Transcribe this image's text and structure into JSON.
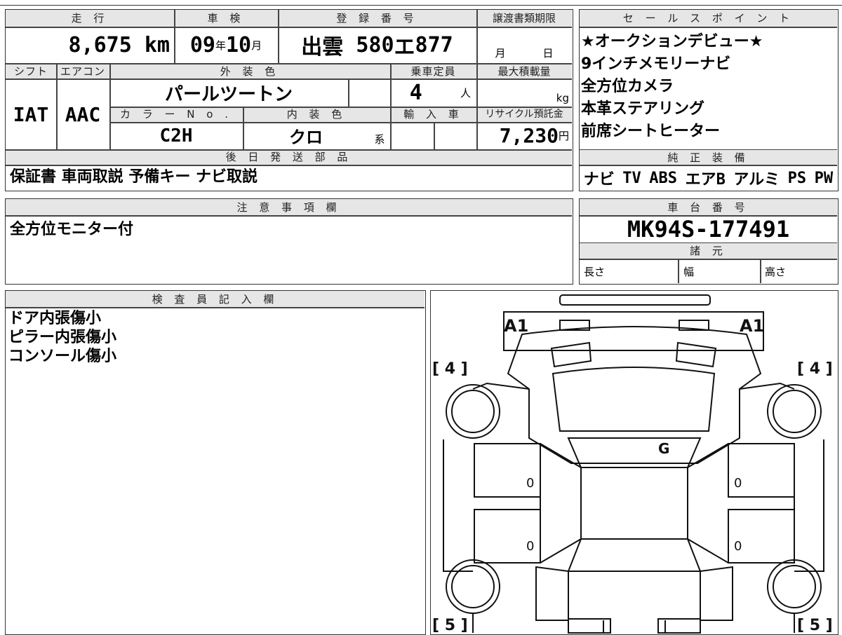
{
  "top": {
    "mileage_label": "走 行",
    "shaken_label": "車 検",
    "reg_label": "登 録 番 号",
    "transfer_label": "譲渡書類期限",
    "mileage": "8,675",
    "mileage_unit": "km",
    "shaken_year": "09",
    "shaken_year_unit": "年",
    "shaken_month": "10",
    "shaken_month_unit": "月",
    "reg_place": "出雲",
    "reg_class": "580",
    "reg_kana": "エ",
    "reg_number": "877",
    "transfer_month_unit": "月",
    "transfer_day_unit": "日",
    "shift_label": "シフト",
    "ac_label": "エアコン",
    "ext_color_label": "外 装 色",
    "capacity_label": "乗車定員",
    "max_load_label": "最大積載量",
    "shift": "IAT",
    "ac": "AAC",
    "ext_color": "パールツートン",
    "capacity": "4",
    "capacity_unit": "人",
    "load_unit": "kg",
    "color_no_label": "カ ラ ー N o .",
    "int_color_label": "内 装 色",
    "import_label": "輸 入 車",
    "recycle_label": "リサイクル預託金",
    "color_no": "C2H",
    "int_color": "クロ",
    "int_color_suffix": "系",
    "recycle": "7,230",
    "recycle_unit": "円",
    "later_label": "後 日 発 送 部 品",
    "later_items": "保証書 車両取説 予備キー ナビ取説"
  },
  "sales": {
    "label": "セ ー ル ス ポ イ ン ト",
    "points": [
      "★オークションデビュー★",
      "9インチメモリーナビ",
      "全方位カメラ",
      "本革ステアリング",
      "前席シートヒーター"
    ],
    "equip_label": "純 正 装 備",
    "equipment": [
      "ナビ",
      "TV",
      "ABS",
      "エアB",
      "アルミ",
      "PS",
      "PW"
    ]
  },
  "notes": {
    "label": "注 意 事 項 欄",
    "text": "全方位モニター付"
  },
  "chassis": {
    "label": "車 台 番 号",
    "number": "MK94S-177491",
    "spec_label": "諸 元",
    "length_label": "長さ",
    "width_label": "幅",
    "height_label": "高さ"
  },
  "inspector": {
    "label": "検 査 員 記 入 欄",
    "lines": [
      "ドア内張傷小",
      "ピラー内張傷小",
      "コンソール傷小"
    ]
  },
  "diagram": {
    "marks": {
      "front_left": "A1",
      "front_right": "A1",
      "front_wheel_left": "[ 4 ]",
      "front_wheel_right": "[ 4 ]",
      "rear_wheel_left": "[ 5 ]",
      "rear_wheel_right": "[ 5 ]",
      "glass": "G",
      "door_fl": "0",
      "door_rl": "0",
      "door_fr": "0",
      "door_rr": "0"
    }
  }
}
